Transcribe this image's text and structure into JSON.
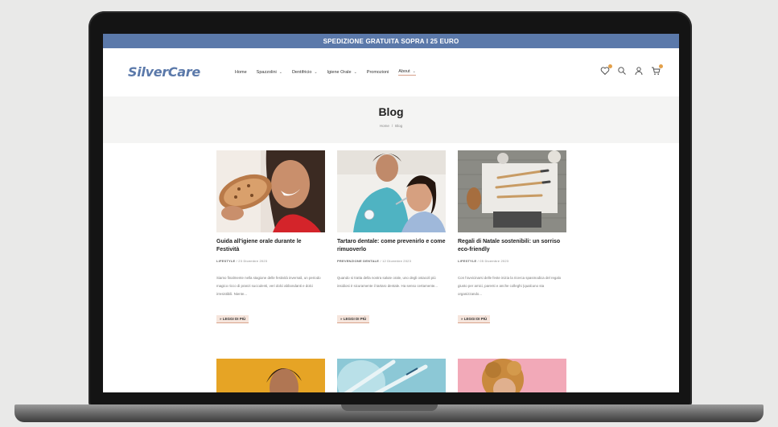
{
  "promo_text": "SPEDIZIONE GRATUITA SOPRA I 25 EURO",
  "brand": "SilverCare",
  "nav": [
    {
      "label": "Home",
      "dropdown": false
    },
    {
      "label": "Spazzolini",
      "dropdown": true
    },
    {
      "label": "Dentifricio",
      "dropdown": true
    },
    {
      "label": "Igiene Orale",
      "dropdown": true
    },
    {
      "label": "Promozioni",
      "dropdown": false
    },
    {
      "label": "About",
      "dropdown": true
    }
  ],
  "icons": [
    "wishlist-icon",
    "search-icon",
    "account-icon",
    "cart-icon"
  ],
  "page_title": "Blog",
  "breadcrumb": {
    "home": "Home",
    "separator": "/",
    "current": "Blog"
  },
  "posts": [
    {
      "title": "Guida all'igiene orale durante le Festività",
      "category": "LIFESTYLE",
      "date": "23 Dicembre 2023",
      "excerpt": "Siamo finalmente nella stagione delle festività invernali, un periodo magico ricco di pranzi succulenti, veri dolci abbondanti e dolci irresistibili. Niente...",
      "more": "» LEGGI DI PIÙ"
    },
    {
      "title": "Tartaro dentale: come prevenirlo e come rimuoverlo",
      "category": "PREVENZIONE DENTALE",
      "date": "12 Dicembre 2023",
      "excerpt": "Quando si tratta della nostra salute orale, uno degli ostacoli più insidiosi è sicuramente il tartaro dentale. Ha senso certamente...",
      "more": "» LEGGI DI PIÙ"
    },
    {
      "title": "Regali di Natale sostenibili: un sorriso eco-friendly",
      "category": "LIFESTYLE",
      "date": "05 Dicembre 2023",
      "excerpt": "Con l'avvicinarsi delle feste inizia la ricerca spasmodica del regalo giusto per amici, parenti e anche colleghi (qualcuno sta organizzando...",
      "more": "» LEGGI DI PIÙ"
    }
  ],
  "colors": {
    "brand": "#5b79aa",
    "accent": "#d9a48c",
    "badge": "#e3a04a"
  }
}
